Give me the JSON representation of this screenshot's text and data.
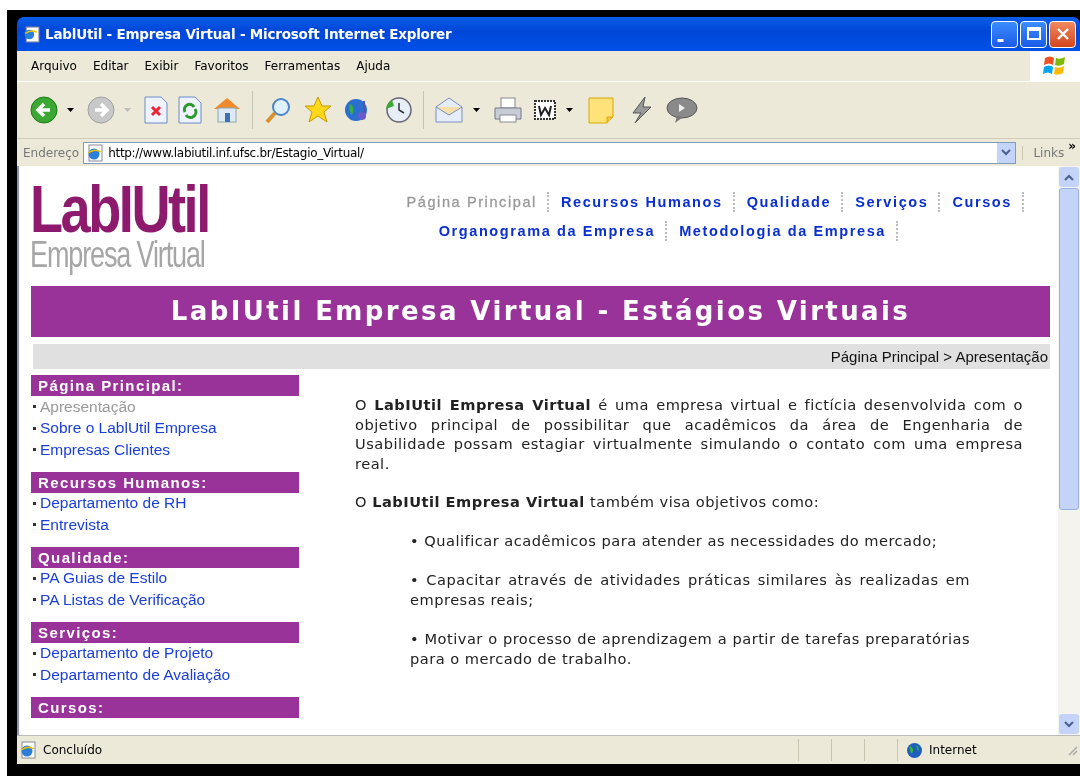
{
  "window": {
    "title": "LablUtil - Empresa Virtual - Microsoft Internet Explorer"
  },
  "menu": [
    "Arquivo",
    "Editar",
    "Exibir",
    "Favoritos",
    "Ferramentas",
    "Ajuda"
  ],
  "address": {
    "label": "Endereço",
    "value": "http://www.labiutil.inf.ufsc.br/Estagio_Virtual/",
    "links": "Links",
    "more": "»"
  },
  "page": {
    "logo": {
      "main": "LabIUtil",
      "sub": "Empresa Virtual"
    },
    "nav": [
      {
        "label": "Página Principal",
        "selected": true
      },
      {
        "label": "Recursos Humanos",
        "selected": false
      },
      {
        "label": "Qualidade",
        "selected": false
      },
      {
        "label": "Serviços",
        "selected": false
      },
      {
        "label": "Cursos",
        "selected": false
      },
      {
        "label": "Organograma da Empresa",
        "selected": false
      },
      {
        "label": "Metodologia da Empresa",
        "selected": false
      }
    ],
    "banner": "LabIUtil Empresa Virtual - Estágios Virtuais",
    "breadcrumb": "Página Principal > Apresentação",
    "sidebar": [
      {
        "heading": "Página Principal:",
        "items": [
          {
            "label": "Apresentação",
            "selected": true
          },
          {
            "label": "Sobre o LablUtil Empresa",
            "selected": false
          },
          {
            "label": "Empresas Clientes",
            "selected": false
          }
        ]
      },
      {
        "heading": "Recursos Humanos:",
        "items": [
          {
            "label": "Departamento de RH",
            "selected": false
          },
          {
            "label": "Entrevista",
            "selected": false
          }
        ]
      },
      {
        "heading": "Qualidade:",
        "items": [
          {
            "label": "PA Guias de Estilo",
            "selected": false
          },
          {
            "label": "PA Listas de Verificação",
            "selected": false
          }
        ]
      },
      {
        "heading": "Serviços:",
        "items": [
          {
            "label": "Departamento de Projeto",
            "selected": false
          },
          {
            "label": "Departamento de Avaliação",
            "selected": false
          }
        ]
      },
      {
        "heading": "Cursos:"
      }
    ],
    "paragraphs": [
      "O **LabIUtil Empresa Virtual** é uma empresa virtual e fictícia desenvolvida com o objetivo principal de possibilitar que acadêmicos da área de Engenharia de Usabilidade possam estagiar virtualmente simulando o contato com uma empresa real.",
      "O **LabIUtil Empresa Virtual** também visa objetivos como:"
    ],
    "bullets": [
      "• Qualificar acadêmicos para atender as necessidades do mercado;",
      "• Capacitar através de atividades práticas similares às realizadas em empresas reais;",
      "• Motivar o processo de aprendizagem a partir de tarefas preparatórias para o mercado de trabalho."
    ]
  },
  "status_bar": {
    "text": "Concluído",
    "zone": "Internet"
  }
}
